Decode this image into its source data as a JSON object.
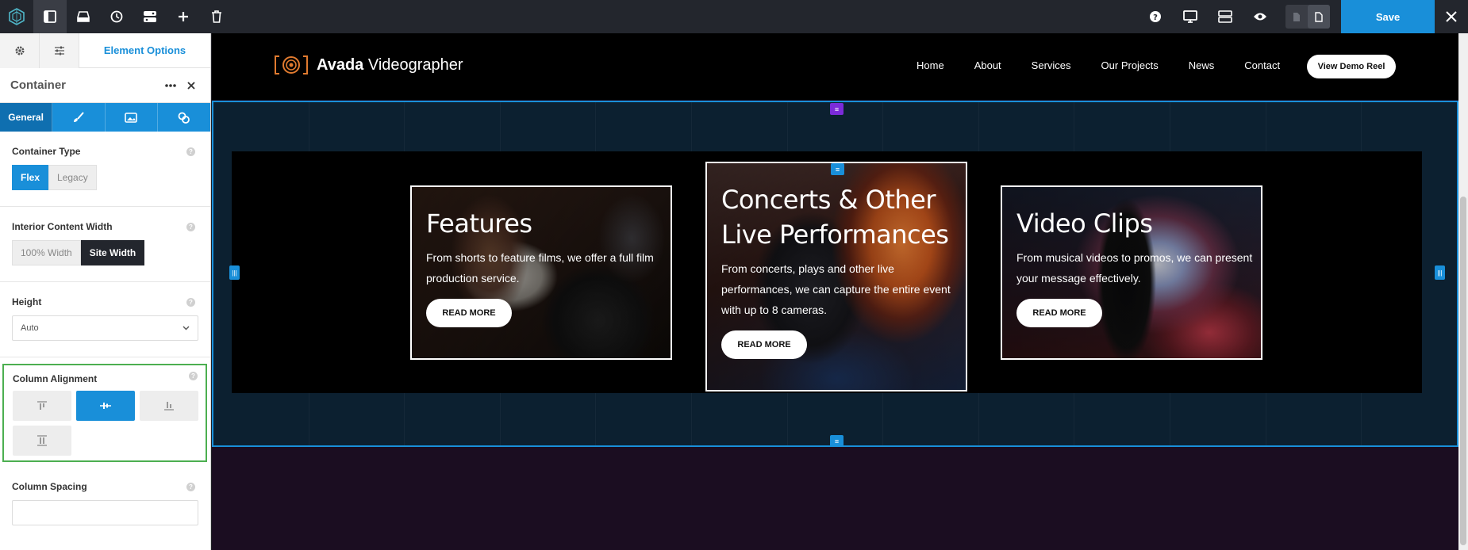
{
  "toolbar": {
    "save_label": "Save",
    "left_icons": [
      "avada-logo-icon",
      "sidebar-toggle-icon",
      "library-icon",
      "history-icon",
      "navigator-icon",
      "add-icon",
      "trash-icon"
    ],
    "right_icons": [
      "help-icon",
      "desktop-icon",
      "responsive-icon",
      "preview-icon",
      "page-icon",
      "page-active-icon",
      "close-icon"
    ]
  },
  "sidebar": {
    "tab_label": "Element Options",
    "title": "Container",
    "sub_tabs": {
      "general": "General",
      "design_icon": "brush-icon",
      "background_icon": "image-icon",
      "extras_icon": "extras-icon"
    },
    "container_type": {
      "label": "Container Type",
      "options": [
        "Flex",
        "Legacy"
      ],
      "selected": "Flex"
    },
    "interior_width": {
      "label": "Interior Content Width",
      "options": [
        "100% Width",
        "Site Width"
      ],
      "selected": "Site Width"
    },
    "height": {
      "label": "Height",
      "value": "Auto"
    },
    "column_alignment": {
      "label": "Column Alignment",
      "options": [
        "align-top-icon",
        "align-center-icon",
        "align-bottom-icon",
        "align-stretch-icon"
      ],
      "selected": "align-center-icon"
    },
    "column_spacing": {
      "label": "Column Spacing",
      "value": ""
    }
  },
  "site": {
    "brand_bold": "Avada",
    "brand_rest": " Videographer",
    "nav": [
      "Home",
      "About",
      "Services",
      "Our Projects",
      "News",
      "Contact"
    ],
    "cta": "View Demo Reel"
  },
  "cards": [
    {
      "title": "Features",
      "text": "From shorts to feature films, we offer a full film production service.",
      "button": "READ MORE"
    },
    {
      "title": "Concerts & Other Live Performances",
      "text": "From concerts, plays and other live performances, we can capture the entire event with up to 8 cameras.",
      "button": "READ MORE"
    },
    {
      "title": "Video Clips",
      "text": "From musical videos to promos, we can present your message effectively.",
      "button": "READ MORE"
    }
  ],
  "colors": {
    "accent": "#198fd9",
    "highlight_outline": "#4caf50",
    "purple_handle": "#7b2bd9",
    "toolbar_bg": "#23262d"
  }
}
